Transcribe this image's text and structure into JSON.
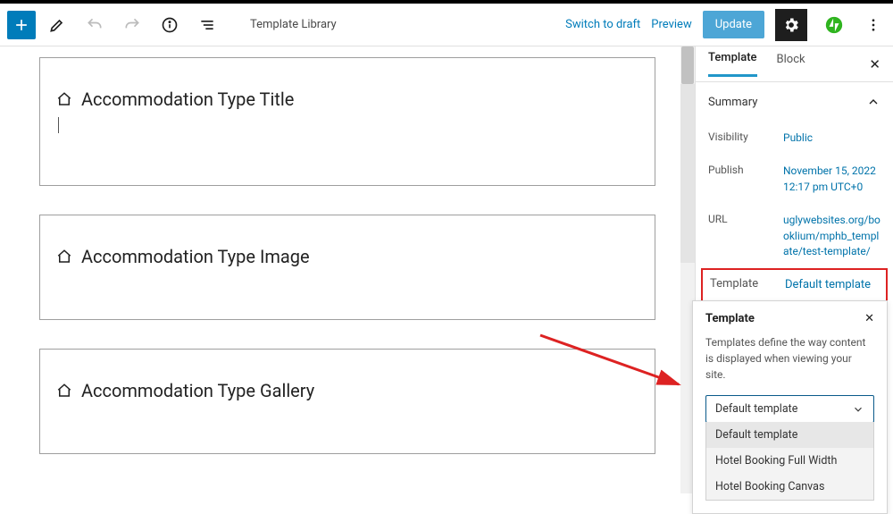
{
  "topbar": {
    "doc_title": "Template Library",
    "switch_to_draft": "Switch to draft",
    "preview": "Preview",
    "update": "Update"
  },
  "blocks": [
    {
      "title": "Accommodation Type Title"
    },
    {
      "title": "Accommodation Type Image"
    },
    {
      "title": "Accommodation Type Gallery"
    }
  ],
  "sidebar": {
    "tabs": {
      "template": "Template",
      "block": "Block"
    },
    "summary_label": "Summary",
    "rows": {
      "visibility": {
        "label": "Visibility",
        "value": "Public"
      },
      "publish": {
        "label": "Publish",
        "value": "November 15, 2022 12:17 pm UTC+0"
      },
      "url": {
        "label": "URL",
        "value": "uglywebsites.org/booklium/mphb_template/test-template/"
      },
      "template": {
        "label": "Template",
        "value": "Default template"
      }
    }
  },
  "template_panel": {
    "title": "Template",
    "desc": "Templates define the way content is displayed when viewing your site.",
    "selected": "Default template",
    "options": [
      "Default template",
      "Hotel Booking Full Width",
      "Hotel Booking Canvas"
    ]
  }
}
